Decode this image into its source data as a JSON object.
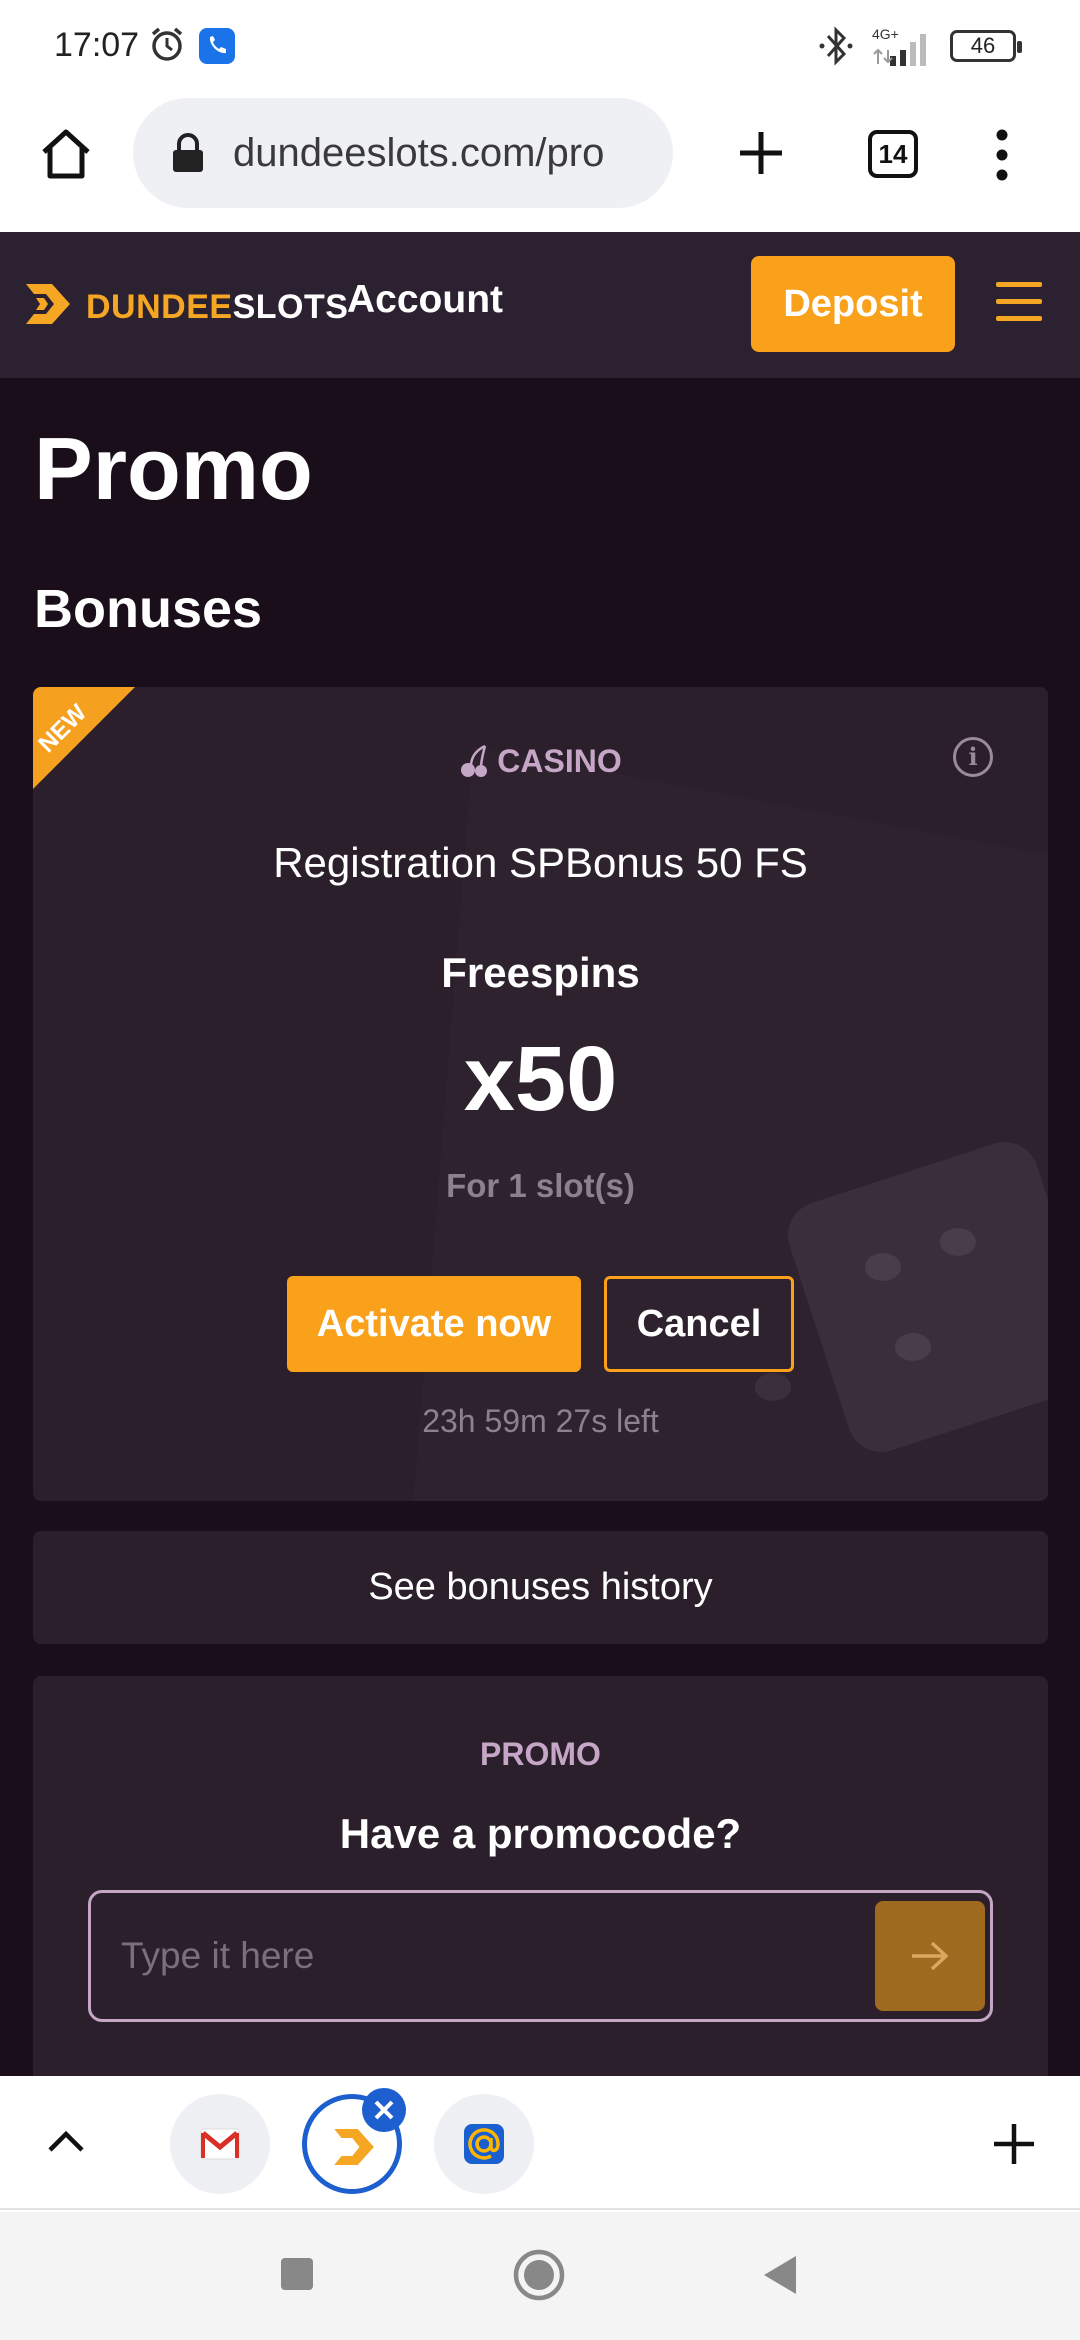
{
  "status_bar": {
    "time": "17:07",
    "network": "4G+",
    "battery": "46",
    "icons": [
      "alarm-icon",
      "phone-call-icon",
      "bluetooth-icon",
      "signal-icon",
      "battery-icon"
    ]
  },
  "browser": {
    "url": "dundeeslots.com/pro",
    "tab_count": "14"
  },
  "header": {
    "logo_part1": "DUNDEE",
    "logo_part2": "SLOTS",
    "account_label": "Account",
    "deposit_label": "Deposit"
  },
  "page": {
    "title": "Promo",
    "bonuses_heading": "Bonuses"
  },
  "bonus_card": {
    "badge": "NEW",
    "category": "CASINO",
    "name": "Registration SPBonus 50 FS",
    "type": "Freespins",
    "amount": "x50",
    "slots": "For 1 slot(s)",
    "activate_label": "Activate now",
    "cancel_label": "Cancel",
    "timer": "23h 59m 27s left"
  },
  "history": {
    "label": "See bonuses history"
  },
  "promo": {
    "label": "PROMO",
    "question": "Have a promocode?",
    "placeholder": "Type it here"
  },
  "colors": {
    "brand_orange": "#f9a11b",
    "header_bg": "#2c2130",
    "page_bg": "#190e19",
    "card_bg": "#2a1f2a",
    "accent_blue": "#1e5fd0"
  }
}
